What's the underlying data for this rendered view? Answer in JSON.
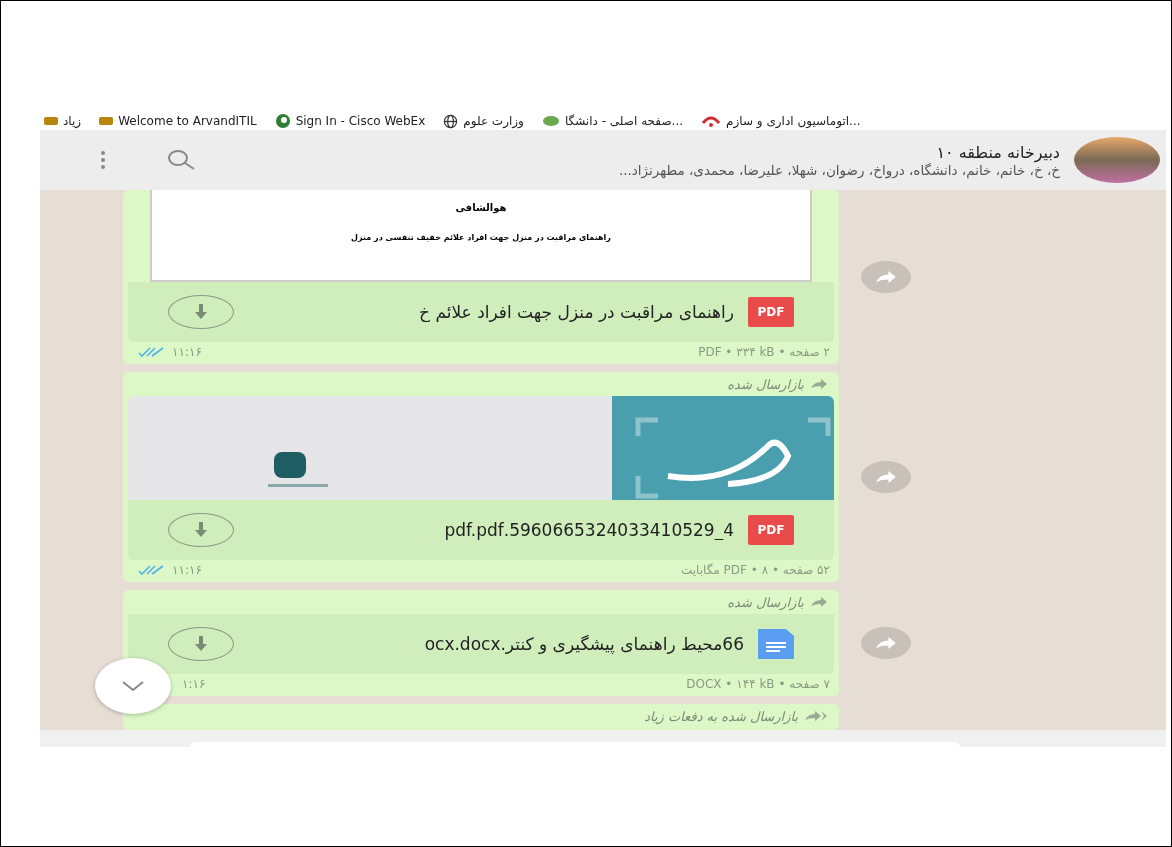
{
  "bookmarks": [
    {
      "kind": "arc",
      "label": "اتوماسیون اداری و سازم..."
    },
    {
      "kind": "leaf",
      "label": "صفحه اصلی - دانشگا..."
    },
    {
      "kind": "globe",
      "label": "وزارت علوم"
    },
    {
      "kind": "webex",
      "label": "Sign In - Cisco WebEx"
    },
    {
      "kind": "site",
      "label": "Welcome to ArvandITIL"
    },
    {
      "kind": "site",
      "label": "زیاد"
    }
  ],
  "chat_header": {
    "title": "دبیرخانه منطقه ۱۰",
    "subtitle": "خ، خ، خانم، خانم، دانشگاه، درواخ، رضوان، شهلا، علیرضا، محمدی، مطهرنژاد..."
  },
  "messages": [
    {
      "kind": "document",
      "forwarded": false,
      "preview": {
        "kind": "page",
        "heading": "هوالشافی",
        "line": "راهنمای مراقبت در منزل جهت افراد علائم خفیف تنفسی در منزل"
      },
      "file_icon": {
        "kind": "pdf",
        "label": "PDF"
      },
      "filename": "راهنمای مراقبت در منزل جهت افراد علائم خ",
      "meta": "۲ صفحه • PDF • ۳۳۴ kB",
      "time": "۱۱:۱۶",
      "read": true
    },
    {
      "kind": "document",
      "forwarded": true,
      "forwarded_many": false,
      "forward_label": "بازارسال شده",
      "preview": {
        "kind": "cover"
      },
      "file_icon": {
        "kind": "pdf",
        "label": "PDF"
      },
      "filename": "4_5960665324033410529.pdf.pdf",
      "meta": "۵۲ صفحه • PDF • ۸ مگابایت",
      "time": "۱۱:۱۶",
      "read": true
    },
    {
      "kind": "document",
      "forwarded": true,
      "forwarded_many": false,
      "forward_label": "بازارسال شده",
      "preview": {
        "kind": "none"
      },
      "file_icon": {
        "kind": "doc"
      },
      "filename": "66محیط راهنمای پیشگیری و کنتر.ocx.docx",
      "meta": "۷ صفحه • DOCX • ۱۴۴ kB",
      "time": "۱:۱۶"
    },
    {
      "kind": "cut",
      "forwarded": true,
      "forwarded_many": true,
      "forward_label": "بازارسال شده به دفعات زیاد"
    }
  ]
}
